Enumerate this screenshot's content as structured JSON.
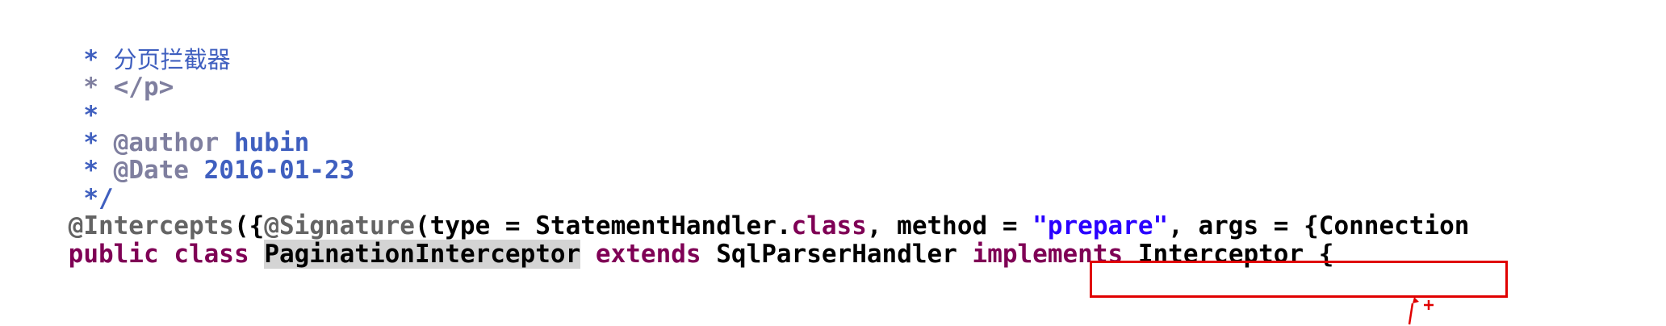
{
  "editor": {
    "lines": [
      {
        "segments": [
          {
            "text": " * ",
            "style": "cmt"
          },
          {
            "text": "分页拦截器",
            "style": "cmt cjk"
          }
        ]
      },
      {
        "segments": [
          {
            "text": " * </p>",
            "style": "tag"
          }
        ]
      },
      {
        "segments": [
          {
            "text": " *",
            "style": "cmt"
          }
        ]
      },
      {
        "segments": [
          {
            "text": " * ",
            "style": "cmt"
          },
          {
            "text": "@author",
            "style": "tag"
          },
          {
            "text": " hubin",
            "style": "cmt"
          }
        ]
      },
      {
        "segments": [
          {
            "text": " * ",
            "style": "cmt"
          },
          {
            "text": "@Date",
            "style": "tag"
          },
          {
            "text": " 2016-01-23",
            "style": "cmt"
          }
        ]
      },
      {
        "segments": [
          {
            "text": " */",
            "style": "cmt"
          }
        ]
      },
      {
        "segments": [
          {
            "text": "@Intercepts",
            "style": "ann"
          },
          {
            "text": "({",
            "style": "plain"
          },
          {
            "text": "@Signature",
            "style": "ann"
          },
          {
            "text": "(type = StatementHandler.",
            "style": "plain"
          },
          {
            "text": "class",
            "style": "kw"
          },
          {
            "text": ", method = ",
            "style": "plain"
          },
          {
            "text": "\"prepare\"",
            "style": "str"
          },
          {
            "text": ", args = {Connection",
            "style": "plain"
          }
        ]
      },
      {
        "segments": [
          {
            "text": "public",
            "style": "kw"
          },
          {
            "text": " ",
            "style": "plain"
          },
          {
            "text": "class",
            "style": "kw"
          },
          {
            "text": " ",
            "style": "plain"
          },
          {
            "text": "PaginationInterceptor",
            "style": "plain hl"
          },
          {
            "text": " ",
            "style": "plain"
          },
          {
            "text": "extends",
            "style": "kw"
          },
          {
            "text": " SqlParserHandler ",
            "style": "plain"
          },
          {
            "text": "implements",
            "style": "kw"
          },
          {
            "text": " Interceptor {",
            "style": "plain"
          }
        ]
      }
    ]
  },
  "annotation": {
    "box_color": "#e00000",
    "arrow_icon": "red-arrow-icon"
  }
}
